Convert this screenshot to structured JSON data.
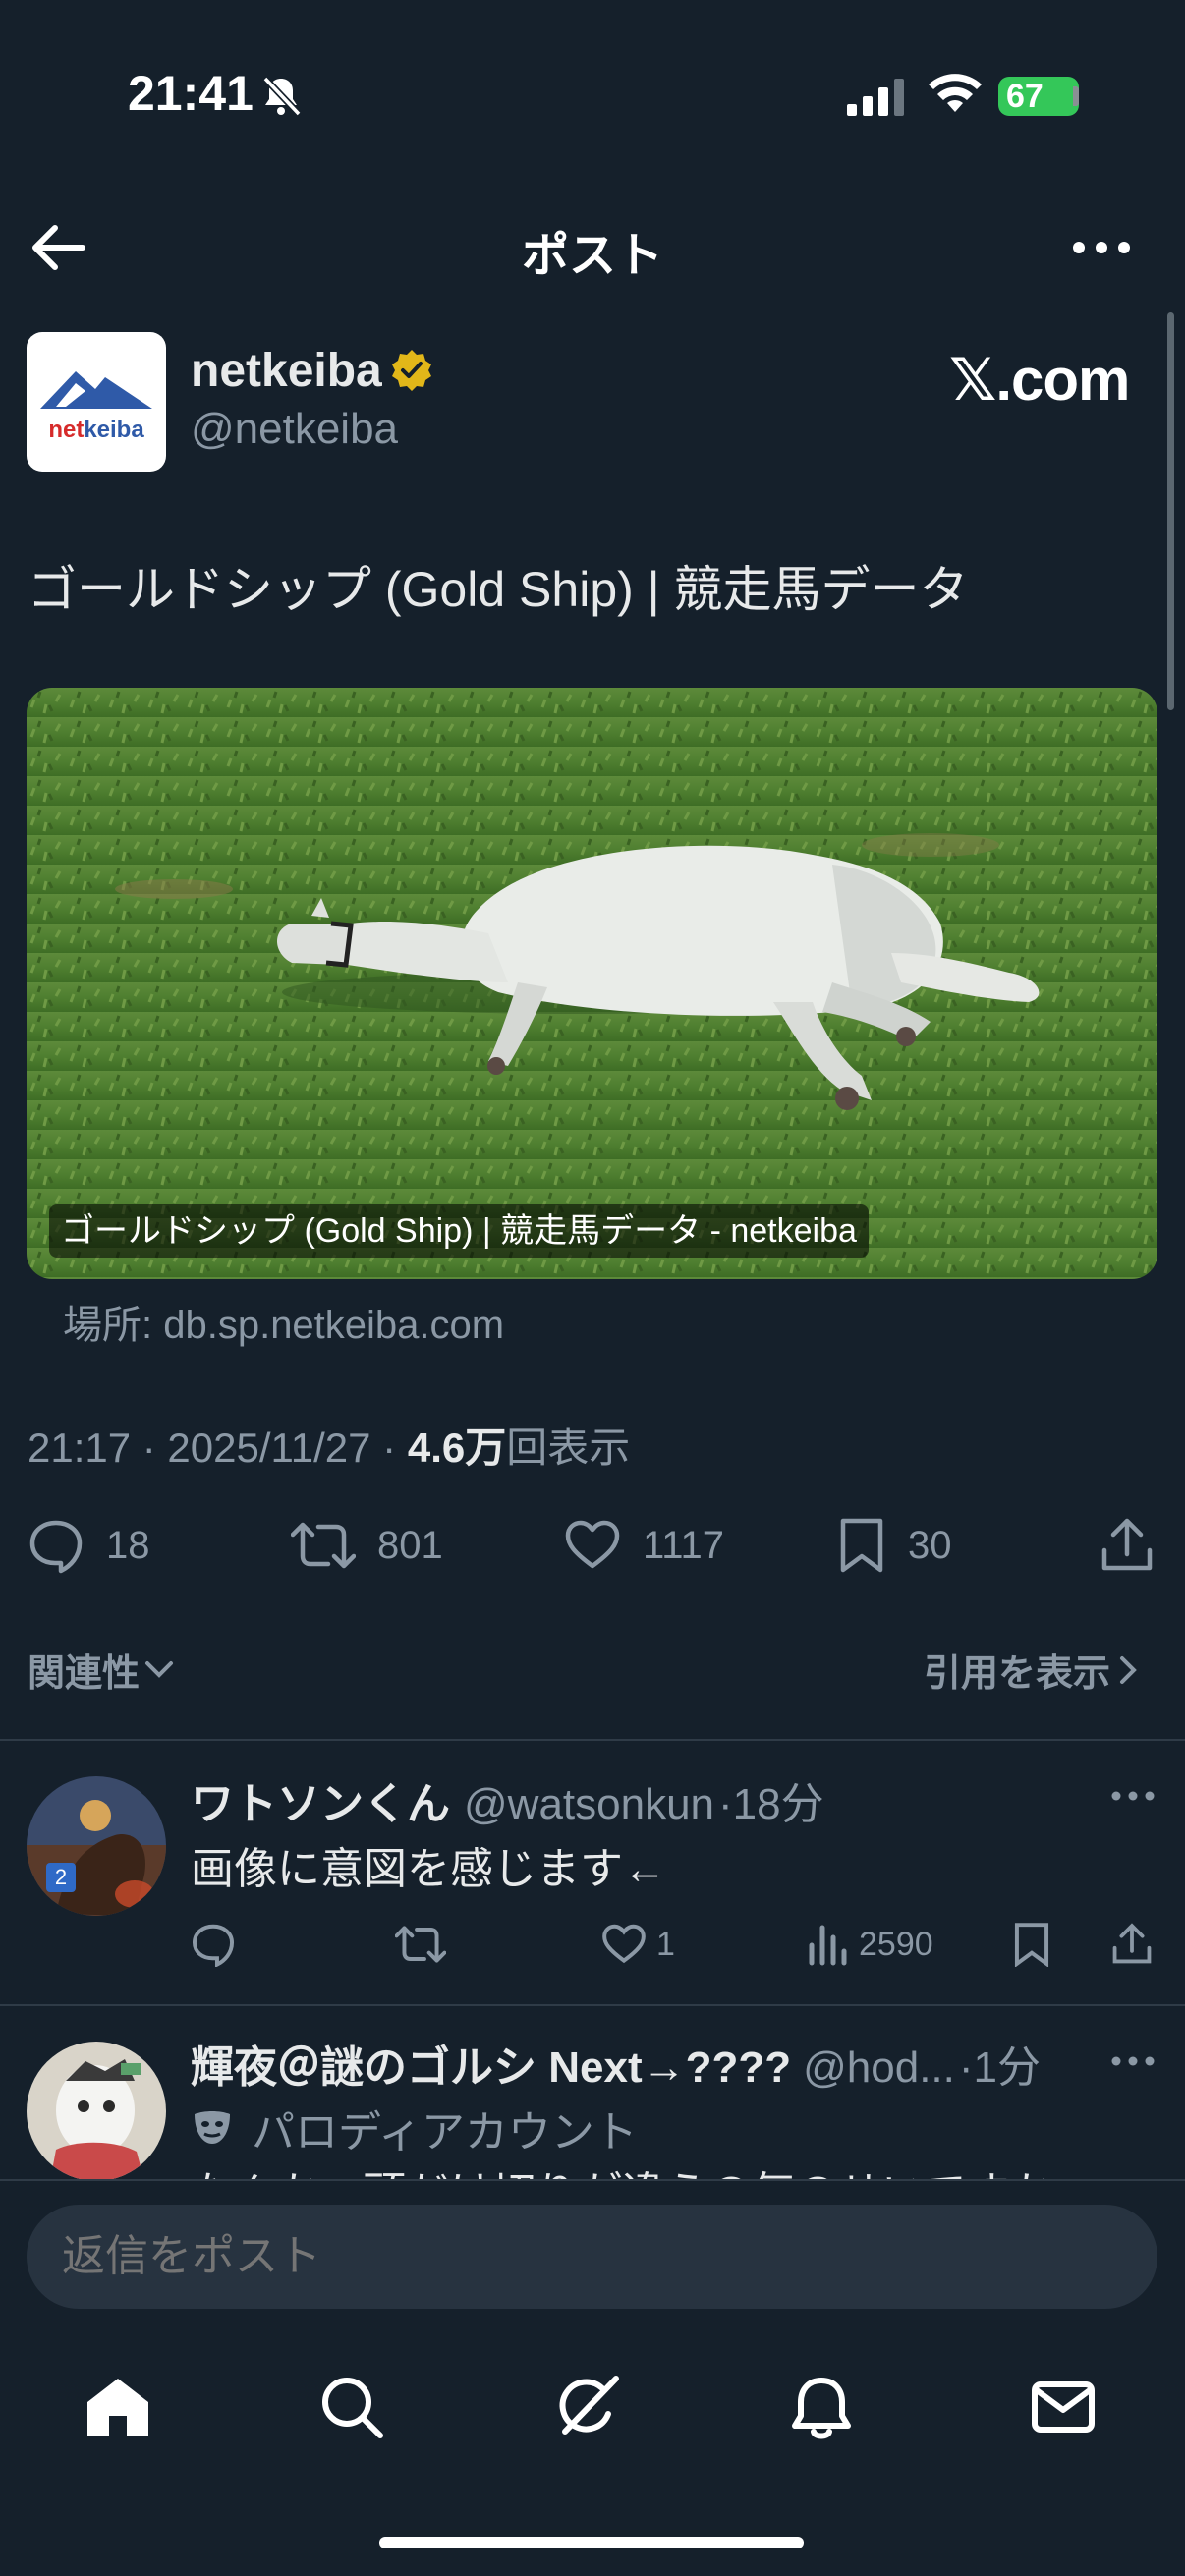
{
  "status_bar": {
    "time": "21:41",
    "battery": "67"
  },
  "header": {
    "title": "ポスト"
  },
  "author": {
    "name": "netkeiba",
    "handle": "@netkeiba",
    "avatar_text": "netkeiba",
    "source_badge": "𝕏.com"
  },
  "post": {
    "text": "ゴールドシップ (Gold Ship) | 競走馬データ",
    "card_caption": "ゴールドシップ (Gold Ship) | 競走馬データ - netkeiba",
    "card_domain": "場所: db.sp.netkeiba.com",
    "meta_time": "21:17 · 2025/11/27 · ",
    "meta_views": "4.6万",
    "meta_views_suffix": "回表示"
  },
  "actions": {
    "replies": "18",
    "reposts": "801",
    "likes": "1117",
    "bookmarks": "30"
  },
  "sort": {
    "label": "関連性",
    "quotes": "引用を表示"
  },
  "replies": [
    {
      "name": "ワトソンくん",
      "handle": "@watsonkun",
      "time": "·18分",
      "text": "画像に意図を感じます←",
      "likes": "1",
      "views": "2590"
    },
    {
      "name": "輝夜＠謎のゴルシ Next→????",
      "handle": "@hod...",
      "time": "·1分",
      "parody": "パロディアカウント",
      "text": "なんか、頭だけ切りが違うの気のせいですか"
    }
  ],
  "reply_box": {
    "placeholder": "返信をポスト"
  },
  "colors": {
    "background": "#15202b",
    "text": "#e7e9ea",
    "muted": "#8b98a5",
    "verified": "#e2b719",
    "battery": "#34c759"
  }
}
